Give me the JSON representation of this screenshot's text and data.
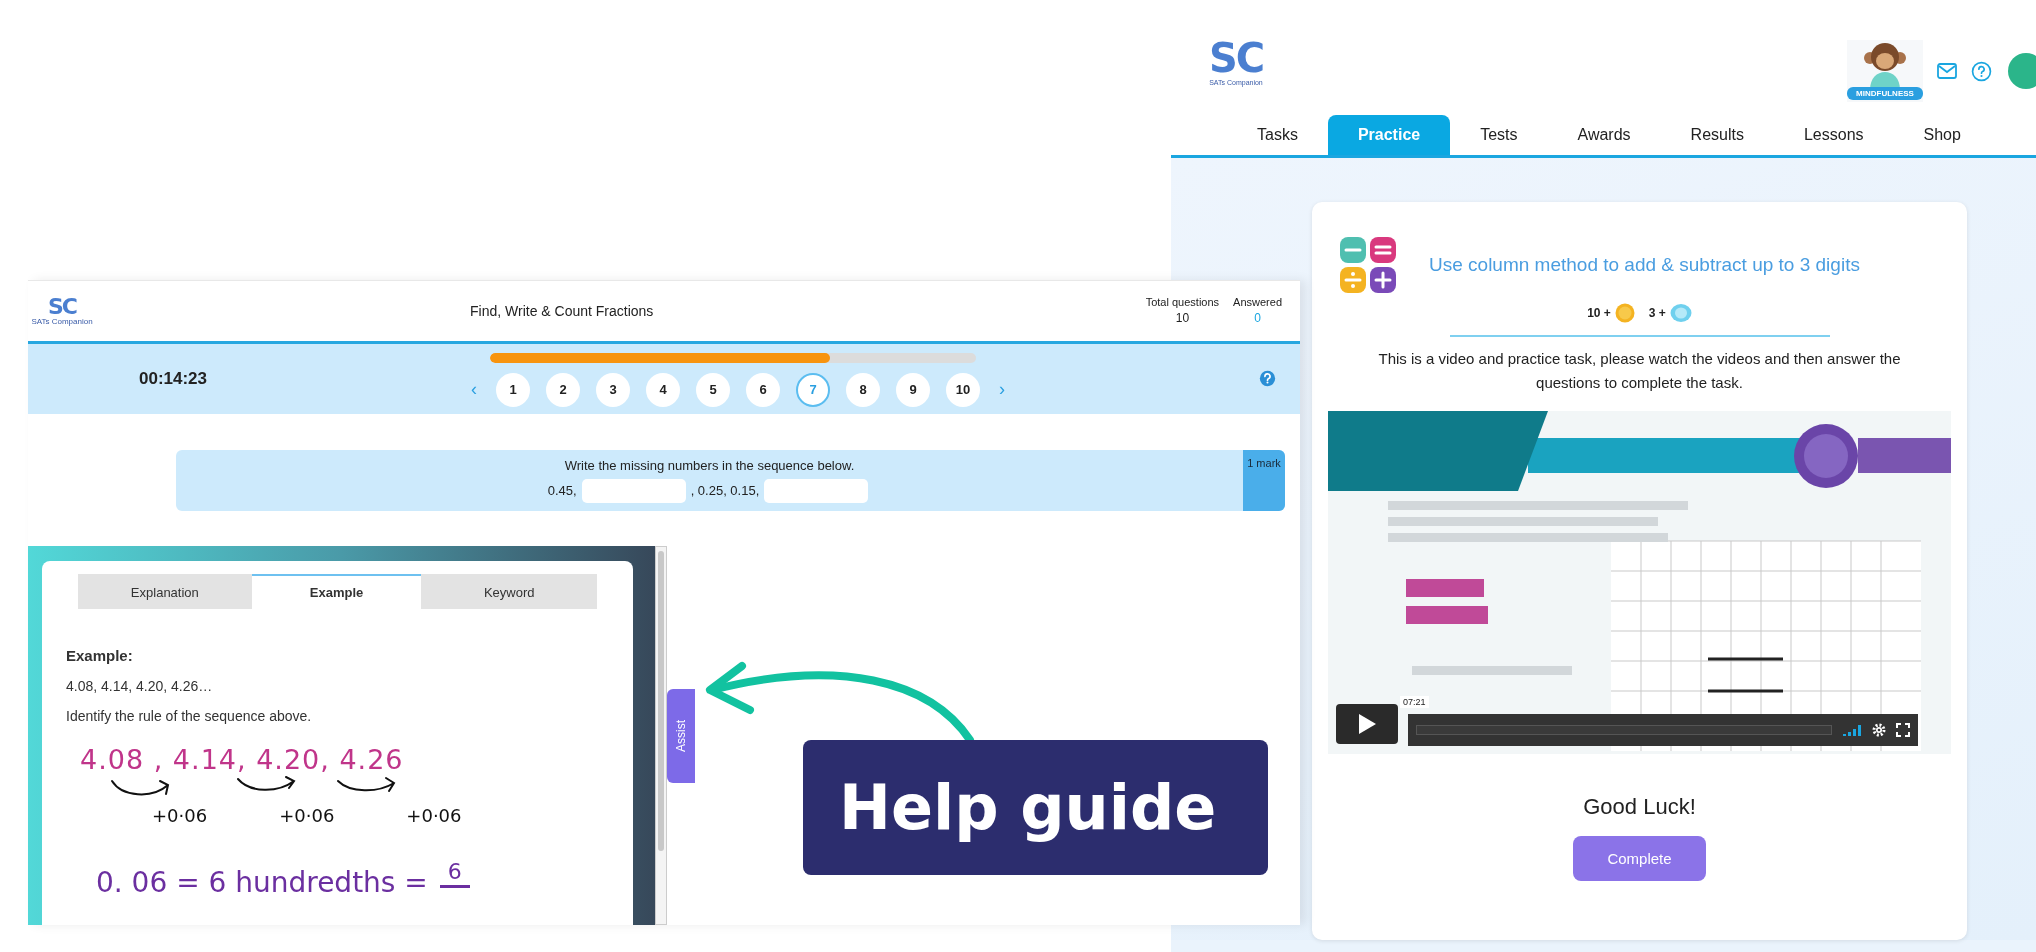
{
  "quiz_window": {
    "logo": {
      "mark": "SC",
      "name": "SATs Companion"
    },
    "title": "Find, Write & Count Fractions",
    "stats": [
      {
        "label": "Total questions",
        "value": "10",
        "kind": "plain"
      },
      {
        "label": "Answered",
        "value": "0",
        "kind": "accent"
      }
    ],
    "timer": "00:14:23",
    "progress": {
      "level": 0.7
    },
    "prev": "‹",
    "next": "›",
    "questions": [
      {
        "label": "1",
        "selected": false
      },
      {
        "label": "2",
        "selected": false
      },
      {
        "label": "3",
        "selected": false
      },
      {
        "label": "4",
        "selected": false
      },
      {
        "label": "5",
        "selected": false
      },
      {
        "label": "6",
        "selected": false
      },
      {
        "label": "7",
        "selected": true
      },
      {
        "label": "8",
        "selected": false
      },
      {
        "label": "9",
        "selected": false
      },
      {
        "label": "10",
        "selected": false
      }
    ],
    "question": {
      "prompt": "Write the missing numbers in the sequence below.",
      "parts": [
        {
          "kind": "text",
          "text": "0.45,"
        },
        {
          "kind": "blank"
        },
        {
          "kind": "text",
          "text": ", 0.25, 0.15,"
        },
        {
          "kind": "blank"
        }
      ],
      "marks": "1 mark"
    },
    "help_panel": {
      "tabs": [
        {
          "label": "Explanation",
          "selected": false
        },
        {
          "label": "Example",
          "selected": true
        },
        {
          "label": "Keyword",
          "selected": false
        }
      ],
      "heading": "Example:",
      "lines": [
        "4.08, 4.14, 4.20, 4.26…",
        "Identify the rule of the sequence above."
      ],
      "handwriting": {
        "sequence": "4.08 , 4.14, 4.20, 4.26",
        "steps": [
          "+0·06",
          "+0·06",
          "+0·06"
        ],
        "equation": "0. 06 = 6 hundredths =",
        "numerator": "6"
      },
      "assist": "Assist"
    }
  },
  "callout": "Help guide",
  "practice_window": {
    "logo": {
      "mark": "SC",
      "name": "SATs Companion"
    },
    "badge": "MINDFULNESS",
    "nav": [
      {
        "label": "Tasks",
        "selected": false
      },
      {
        "label": "Practice",
        "selected": true
      },
      {
        "label": "Tests",
        "selected": false
      },
      {
        "label": "Awards",
        "selected": false
      },
      {
        "label": "Results",
        "selected": false
      },
      {
        "label": "Lessons",
        "selected": false
      },
      {
        "label": "Shop",
        "selected": false
      }
    ],
    "task": {
      "title": "Use column method to add & subtract up to 3 digits",
      "rewards": [
        {
          "amount": "10 +",
          "kind": "coin"
        },
        {
          "amount": "3 +",
          "kind": "gem"
        }
      ],
      "description": "This is a video and practice task, please watch the videos and then answer the questions to complete the task.",
      "video": {
        "kind": "picture",
        "time": "07:21"
      },
      "closing": "Good Luck!",
      "button": "Complete"
    }
  }
}
